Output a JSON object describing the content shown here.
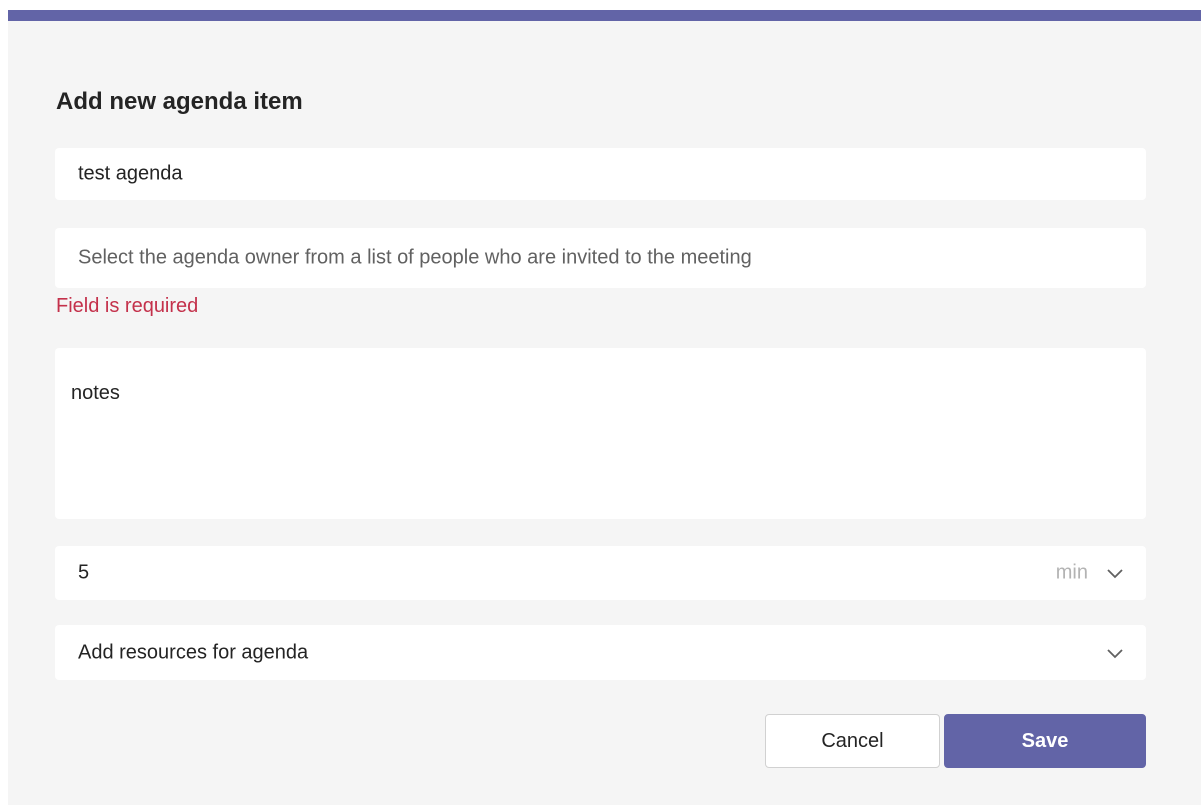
{
  "dialog": {
    "title": "Add new agenda item",
    "accent_color": "#6264a7"
  },
  "form": {
    "name_value": "test agenda",
    "owner_placeholder": "Select the agenda owner from a list of people who are invited to the meeting",
    "owner_error": "Field is required",
    "error_color": "#c4314b",
    "notes_value": "notes",
    "duration_value": "5",
    "duration_unit": "min",
    "duration_icon": "chevron-down-icon",
    "resources_label": "Add resources for agenda",
    "resources_icon": "chevron-down-icon"
  },
  "actions": {
    "cancel_label": "Cancel",
    "save_label": "Save"
  }
}
